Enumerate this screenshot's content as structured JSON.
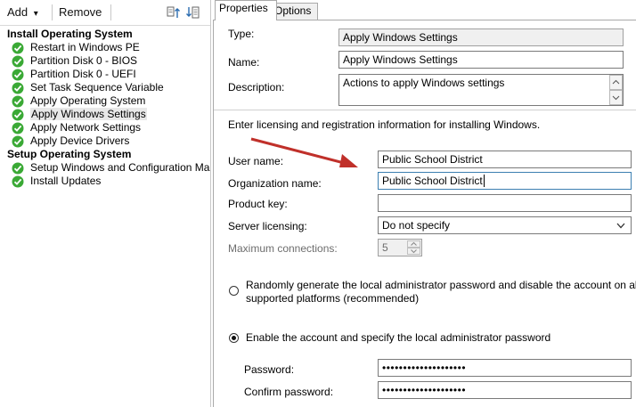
{
  "toolbar": {
    "add_label": "Add",
    "remove_label": "Remove",
    "dropdown_glyph": "▾"
  },
  "tree": {
    "groups": [
      {
        "name": "Install Operating System",
        "steps": [
          "Restart in Windows PE",
          "Partition Disk 0 - BIOS",
          "Partition Disk 0 - UEFI",
          "Set Task Sequence Variable",
          "Apply Operating System",
          "Apply Windows Settings",
          "Apply Network Settings",
          "Apply Device Drivers"
        ]
      },
      {
        "name": "Setup Operating System",
        "steps": [
          "Setup Windows and Configuration Mar",
          "Install Updates"
        ]
      }
    ],
    "selected_step": "Apply Windows Settings"
  },
  "tabs": [
    "Properties",
    "Options"
  ],
  "active_tab": "Properties",
  "form": {
    "type_label": "Type:",
    "type_value": "Apply Windows Settings",
    "name_label": "Name:",
    "name_value": "Apply Windows Settings",
    "description_label": "Description:",
    "description_value": "Actions to apply Windows settings",
    "instructions": "Enter licensing and registration information for installing Windows.",
    "user_name_label": "User name:",
    "user_name_value": "Public School District",
    "org_name_label": "Organization name:",
    "org_name_value": "Public School District",
    "product_key_label": "Product key:",
    "product_key_value": "",
    "server_licensing_label": "Server licensing:",
    "server_licensing_value": "Do not specify",
    "max_connections_label": "Maximum connections:",
    "max_connections_value": "5",
    "radio_random_label": "Randomly generate the local administrator password and disable the account on all",
    "radio_random_label_line2": "supported platforms (recommended)",
    "radio_enable_label": "Enable the account and specify the local administrator password",
    "password_label": "Password:",
    "password_value": "••••••••••••••••••••",
    "confirm_password_label": "Confirm password:",
    "confirm_password_value": "••••••••••••••••••••"
  },
  "colors": {
    "check_green": "#3aa935",
    "annotation_arrow": "#c0302a",
    "focus_border": "#3c7fb1"
  },
  "icons": [
    "check-icon",
    "move-up-icon",
    "move-down-icon",
    "dropdown-arrow-icon",
    "spin-arrows-icon",
    "scroll-arrows-icon"
  ]
}
